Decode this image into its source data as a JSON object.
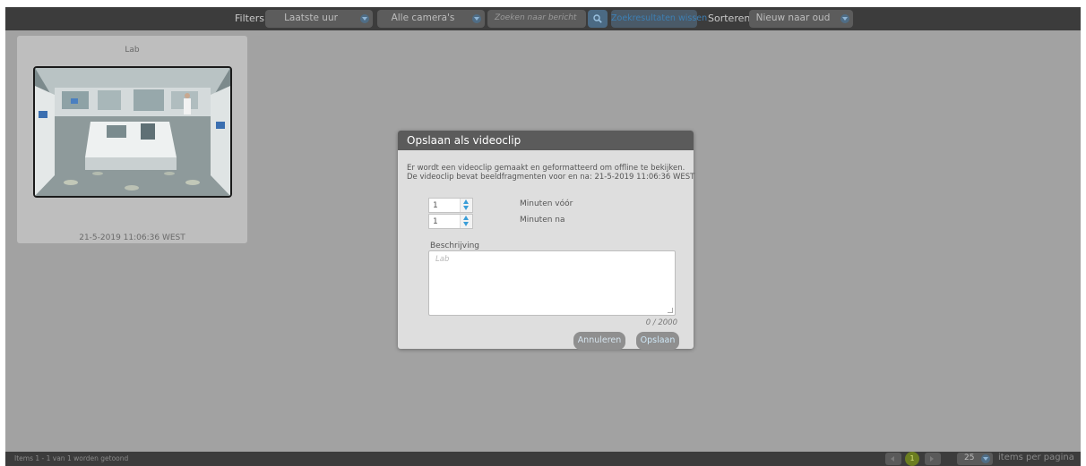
{
  "toolbar": {
    "filters_label": "Filters:",
    "time_filter": "Laatste uur",
    "camera_filter": "Alle camera's",
    "search_placeholder": "Zoeken naar bericht",
    "clear_label": "Zoekresultaten wissen",
    "sort_label": "Sorteren:",
    "sort_value": "Nieuw naar oud"
  },
  "thumbnail": {
    "camera_name": "Lab",
    "timestamp": "21-5-2019 11:06:36 WEST"
  },
  "footer": {
    "status": "Items 1 - 1 van 1 worden getoond",
    "current_page": "1",
    "per_page_value": "25",
    "per_page_label": "items per pagina"
  },
  "dialog": {
    "title": "Opslaan als videoclip",
    "description_line1": "Er wordt een videoclip gemaakt en geformatteerd om offline te bekijken.",
    "description_line2": "De videoclip bevat beeldfragmenten voor en na: 21-5-2019 11:06:36 WEST",
    "minutes_before_value": "1",
    "minutes_before_label": "Minuten vóór",
    "minutes_after_value": "1",
    "minutes_after_label": "Minuten na",
    "description_label": "Beschrijving",
    "description_placeholder": "Lab",
    "char_count": "0 / 2000",
    "cancel_label": "Annuleren",
    "save_label": "Opslaan"
  },
  "colors": {
    "overlay_gray": "#a2a2a2",
    "bar_dark": "#3c3c3c",
    "dialog_header": "#5b5b5b",
    "spinner_blue": "#3a9ed8",
    "page_active": "#6b7d20"
  }
}
